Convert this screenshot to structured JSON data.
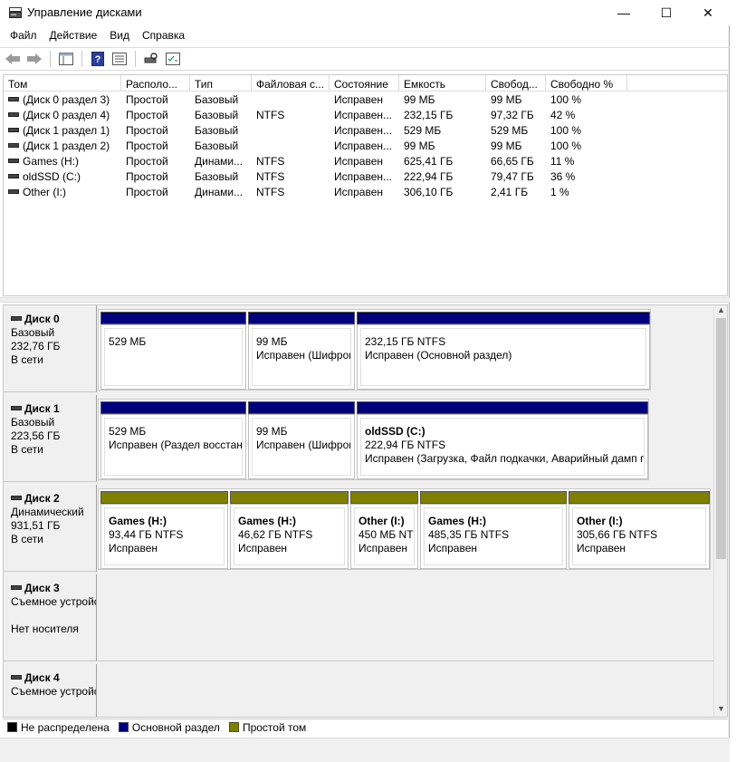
{
  "window": {
    "title": "Управление дисками",
    "minimize": "—",
    "maximize": "☐",
    "close": "✕"
  },
  "menu": [
    "Файл",
    "Действие",
    "Вид",
    "Справка"
  ],
  "volume_list": {
    "columns": [
      "Том",
      "Располо...",
      "Тип",
      "Файловая с...",
      "Состояние",
      "Емкость",
      "Свобод...",
      "Свободно %"
    ],
    "rows": [
      [
        "(Диск 0 раздел 3)",
        "Простой",
        "Базовый",
        "",
        "Исправен",
        "99 МБ",
        "99 МБ",
        "100 %"
      ],
      [
        "(Диск 0 раздел 4)",
        "Простой",
        "Базовый",
        "NTFS",
        "Исправен...",
        "232,15 ГБ",
        "97,32 ГБ",
        "42 %"
      ],
      [
        "(Диск 1 раздел 1)",
        "Простой",
        "Базовый",
        "",
        "Исправен...",
        "529 МБ",
        "529 МБ",
        "100 %"
      ],
      [
        "(Диск 1 раздел 2)",
        "Простой",
        "Базовый",
        "",
        "Исправен...",
        "99 МБ",
        "99 МБ",
        "100 %"
      ],
      [
        "Games (H:)",
        "Простой",
        "Динами...",
        "NTFS",
        "Исправен",
        "625,41 ГБ",
        "66,65 ГБ",
        "11 %"
      ],
      [
        "oldSSD (C:)",
        "Простой",
        "Базовый",
        "NTFS",
        "Исправен...",
        "222,94 ГБ",
        "79,47 ГБ",
        "36 %"
      ],
      [
        "Other (I:)",
        "Простой",
        "Динами...",
        "NTFS",
        "Исправен",
        "306,10 ГБ",
        "2,41 ГБ",
        "1 %"
      ]
    ]
  },
  "disks": [
    {
      "name": "Диск 0",
      "type": "Базовый",
      "size": "232,76 ГБ",
      "status": "В сети",
      "partitions": [
        {
          "title": "",
          "size": "529 МБ",
          "status": ""
        },
        {
          "title": "",
          "size": "99 МБ",
          "status": "Исправен (Шифрованный (EFI) системный раздел)"
        },
        {
          "title": "",
          "size": "232,15 ГБ NTFS",
          "status": "Исправен (Основной раздел)"
        }
      ]
    },
    {
      "name": "Диск 1",
      "type": "Базовый",
      "size": "223,56 ГБ",
      "status": "В сети",
      "partitions": [
        {
          "title": "",
          "size": "529 МБ",
          "status": "Исправен (Раздел восстановления)"
        },
        {
          "title": "",
          "size": "99 МБ",
          "status": "Исправен (Шифрованный (EFI) системный раздел)"
        },
        {
          "title": "oldSSD  (C:)",
          "size": "222,94 ГБ NTFS",
          "status": "Исправен (Загрузка, Файл подкачки, Аварийный дамп памяти, Основной раздел)"
        }
      ]
    },
    {
      "name": "Диск 2",
      "type": "Динамический",
      "size": "931,51 ГБ",
      "status": "В сети",
      "partitions": [
        {
          "title": "Games  (H:)",
          "size": "93,44 ГБ NTFS",
          "status": "Исправен"
        },
        {
          "title": "Games  (H:)",
          "size": "46,62 ГБ NTFS",
          "status": "Исправен"
        },
        {
          "title": "Other  (I:)",
          "size": "450 МБ NTFS",
          "status": "Исправен"
        },
        {
          "title": "Games  (H:)",
          "size": "485,35 ГБ NTFS",
          "status": "Исправен"
        },
        {
          "title": "Other  (I:)",
          "size": "305,66 ГБ NTFS",
          "status": "Исправен"
        }
      ]
    },
    {
      "name": "Диск 3",
      "type": "Съемное устройство",
      "size": "",
      "status": "Нет носителя"
    },
    {
      "name": "Диск 4",
      "type": "Съемное устройство",
      "size": "",
      "status": ""
    }
  ],
  "legend": [
    {
      "label": "Не распределена",
      "color": "#000000"
    },
    {
      "label": "Основной раздел",
      "color": "#00007f"
    },
    {
      "label": "Простой том",
      "color": "#7f7f00"
    }
  ],
  "colors": {
    "primary": "#00007f",
    "simple": "#7f7f00"
  }
}
